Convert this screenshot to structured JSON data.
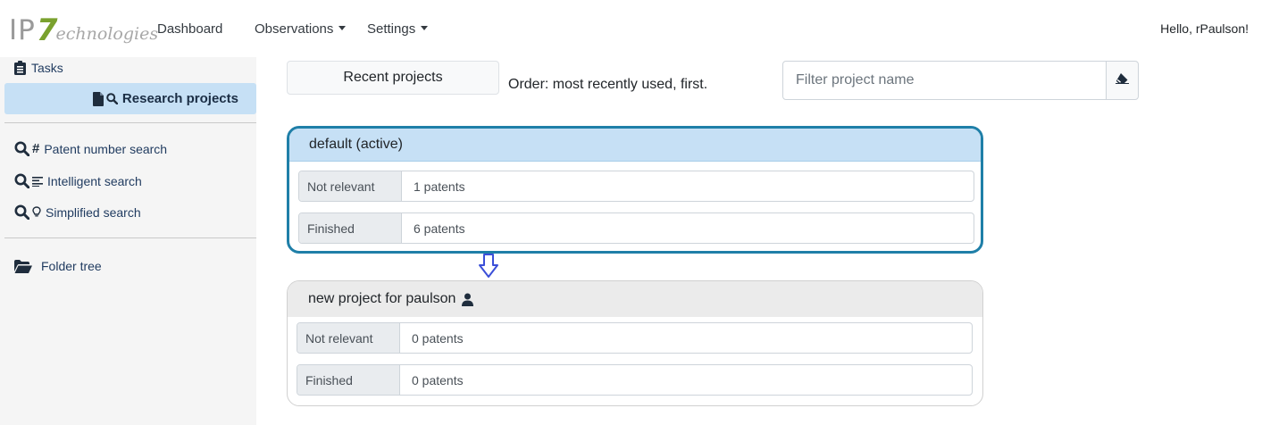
{
  "brand": {
    "ip": "IP",
    "seven": "7",
    "tech": "echnologies",
    "accent": "#7aa12e"
  },
  "nav": {
    "dashboard": "Dashboard",
    "observations": "Observations",
    "settings": "Settings",
    "greeting": "Hello, rPaulson!"
  },
  "sidebar": {
    "tasks": "Tasks",
    "research_projects": "Research projects",
    "patent_number_search": "Patent number search",
    "intelligent_search": "Intelligent search",
    "simplified_search": "Simplified search",
    "folder_tree": "Folder tree",
    "icons": [
      "clipboard-icon",
      "file-icon",
      "search-icon",
      "hash-icon",
      "lines-icon",
      "lightbulb-icon",
      "folder-open-icon"
    ]
  },
  "toolbar": {
    "recent_projects": "Recent projects",
    "order": "Order: most recently used, first.",
    "filter_placeholder": "Filter project name",
    "clear_icon": "eraser-icon"
  },
  "projects": [
    {
      "name": "default (active)",
      "active": true,
      "rows": [
        {
          "label": "Not relevant",
          "value": "1 patents"
        },
        {
          "label": "Finished",
          "value": "6 patents"
        }
      ]
    },
    {
      "name": "new project for paulson",
      "active": false,
      "owner_icon": "user-icon",
      "rows": [
        {
          "label": "Not relevant",
          "value": "0 patents"
        },
        {
          "label": "Finished",
          "value": "0 patents"
        }
      ]
    }
  ],
  "colors": {
    "active_header": "#c6e0f5",
    "active_border": "#1f7fa8",
    "arrow": "#3b4fd8"
  }
}
